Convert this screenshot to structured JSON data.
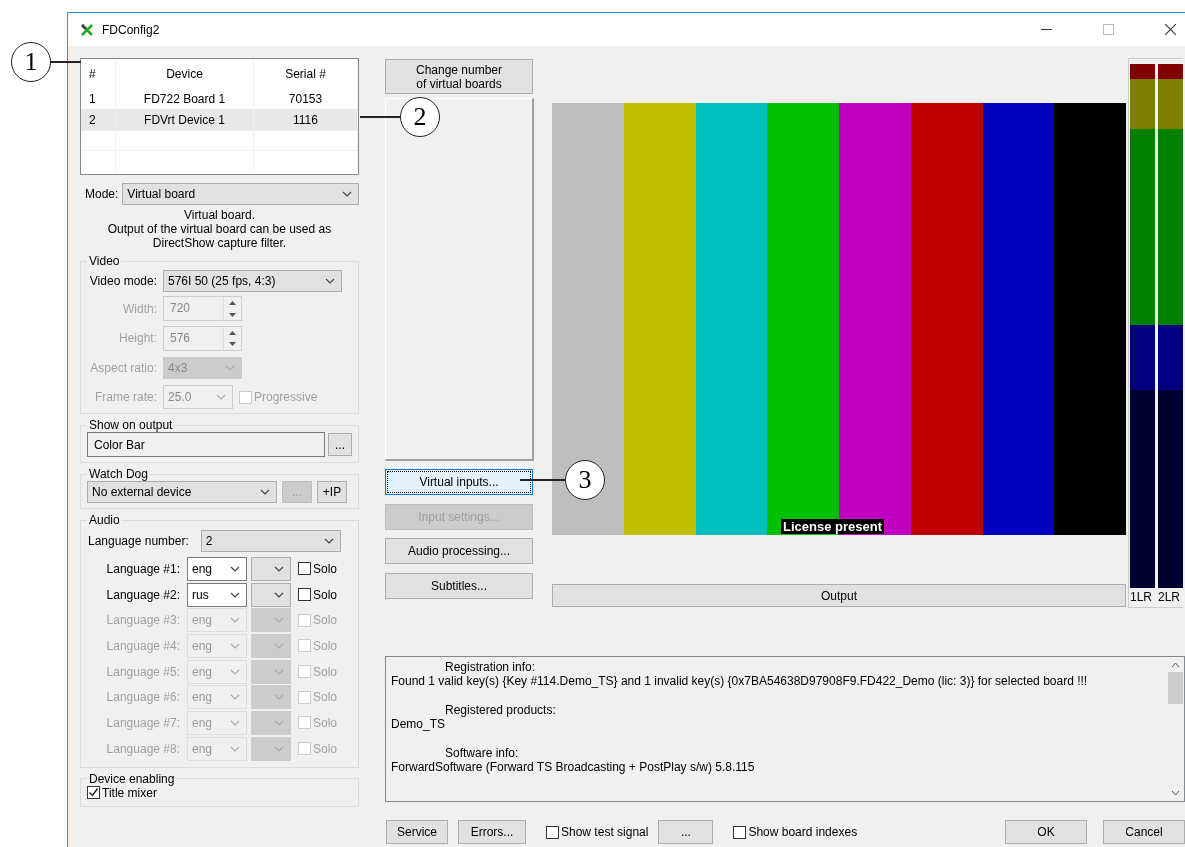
{
  "window": {
    "title": "FDConfig2"
  },
  "callouts": [
    {
      "number": "1",
      "kind": "left"
    },
    {
      "number": "2",
      "kind": "row"
    },
    {
      "number": "3",
      "kind": "button"
    }
  ],
  "device_table": {
    "columns": [
      "#",
      "Device",
      "Serial #"
    ],
    "rows": [
      {
        "cells": [
          "1",
          "FD722 Board 1",
          "70153"
        ],
        "selected": false
      },
      {
        "cells": [
          "2",
          "FDVrt Device 1",
          "1116"
        ],
        "selected": true
      }
    ]
  },
  "mode": {
    "label": "Mode:",
    "value": "Virtual board"
  },
  "mode_description": [
    "Virtual board.",
    "Output of the virtual board can be used as",
    "DirectShow capture filter."
  ],
  "video": {
    "title": "Video",
    "fields": [
      {
        "label": "Video mode:",
        "value": "576I 50 (25 fps, 4:3)",
        "kind": "select",
        "disabled": false
      },
      {
        "label": "Width:",
        "value": "720",
        "kind": "spin",
        "disabled": true
      },
      {
        "label": "Height:",
        "value": "576",
        "kind": "spin",
        "disabled": true
      },
      {
        "label": "Aspect ratio:",
        "value": "4x3",
        "kind": "select-narrow",
        "disabled": true
      },
      {
        "label": "Frame rate:",
        "value": "25.0",
        "kind": "rate",
        "disabled": true
      }
    ],
    "progressive": {
      "label": "Progressive",
      "checked": false,
      "disabled": true
    }
  },
  "show_on_output": {
    "title": "Show on output",
    "value": "Color Bar",
    "button": "..."
  },
  "watch_dog": {
    "title": "Watch Dog",
    "value": "No external device",
    "buttons": [
      {
        "label": "...",
        "disabled": true
      },
      {
        "label": "+IP",
        "disabled": false
      }
    ]
  },
  "audio": {
    "title": "Audio",
    "language_number": {
      "label": "Language number:",
      "value": "2"
    },
    "languages": [
      {
        "label": "Language #1:",
        "value": "eng",
        "disabled": false,
        "solo_label": "Solo",
        "solo_checked": false
      },
      {
        "label": "Language #2:",
        "value": "rus",
        "disabled": false,
        "solo_label": "Solo",
        "solo_checked": false
      },
      {
        "label": "Language #3:",
        "value": "eng",
        "disabled": true,
        "solo_label": "Solo",
        "solo_checked": false
      },
      {
        "label": "Language #4:",
        "value": "eng",
        "disabled": true,
        "solo_label": "Solo",
        "solo_checked": false
      },
      {
        "label": "Language #5:",
        "value": "eng",
        "disabled": true,
        "solo_label": "Solo",
        "solo_checked": false
      },
      {
        "label": "Language #6:",
        "value": "eng",
        "disabled": true,
        "solo_label": "Solo",
        "solo_checked": false
      },
      {
        "label": "Language #7:",
        "value": "eng",
        "disabled": true,
        "solo_label": "Solo",
        "solo_checked": false
      },
      {
        "label": "Language #8:",
        "value": "eng",
        "disabled": true,
        "solo_label": "Solo",
        "solo_checked": false
      }
    ]
  },
  "device_enabling": {
    "title": "Device enabling",
    "checkbox": {
      "label": "Title mixer",
      "checked": true
    }
  },
  "side_buttons": [
    {
      "lines": [
        "Change number",
        "of virtual boards"
      ],
      "disabled": false,
      "focused": false,
      "kind": "top"
    },
    {
      "lines": [
        "Virtual inputs..."
      ],
      "disabled": false,
      "focused": true,
      "kind": "action"
    },
    {
      "lines": [
        "Input settings..."
      ],
      "disabled": true,
      "focused": false,
      "kind": "action"
    },
    {
      "lines": [
        "Audio processing..."
      ],
      "disabled": false,
      "focused": false,
      "kind": "action"
    },
    {
      "lines": [
        "Subtitles..."
      ],
      "disabled": false,
      "focused": false,
      "kind": "action"
    }
  ],
  "preview": {
    "bars": [
      {
        "color": "#bebebe"
      },
      {
        "color": "#bfbf00"
      },
      {
        "color": "#00bfbf"
      },
      {
        "color": "#00bf00"
      },
      {
        "color": "#bf00bf"
      },
      {
        "color": "#bf0000"
      },
      {
        "color": "#0000bf"
      },
      {
        "color": "#000000"
      }
    ],
    "caption": "License present"
  },
  "output_button": "Output",
  "meters": [
    {
      "label": "1LR"
    },
    {
      "label": "2LR"
    }
  ],
  "log": [
    {
      "text": "Registration info:",
      "kind": "heading"
    },
    {
      "text": "Found 1 valid key(s) {Key #114.Demo_TS} and 1 invalid key(s) {0x7BA54638D97908F9.FD422_Demo (lic: 3)} for selected board !!!",
      "kind": "body"
    },
    {
      "text": "Registered products:",
      "kind": "heading"
    },
    {
      "text": "Demo_TS",
      "kind": "body"
    },
    {
      "text": "Software info:",
      "kind": "heading"
    },
    {
      "text": "ForwardSoftware (Forward TS Broadcasting + PostPlay s/w) 5.8.115",
      "kind": "body"
    }
  ],
  "footer": [
    {
      "kind": "button",
      "label": "Service"
    },
    {
      "kind": "button",
      "label": "Errors..."
    },
    {
      "kind": "checkbox",
      "label": "Show test signal",
      "checked": false
    },
    {
      "kind": "button",
      "label": "..."
    },
    {
      "kind": "checkbox",
      "label": "Show board indexes",
      "checked": false
    },
    {
      "kind": "spacer"
    },
    {
      "kind": "button",
      "label": "OK"
    },
    {
      "kind": "button",
      "label": "Cancel"
    }
  ]
}
